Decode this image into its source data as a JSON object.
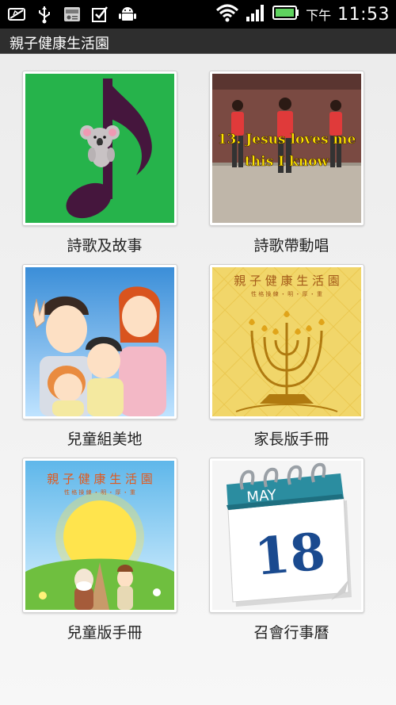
{
  "status_bar": {
    "left_icons": [
      "photo-icon",
      "usb-icon",
      "radio-app-icon",
      "checkbox-icon",
      "android-debug-icon"
    ],
    "right_icons": [
      "wifi-icon",
      "signal-icon",
      "battery-icon"
    ],
    "ampm": "下午",
    "time": "11:53",
    "battery_color": "#5fd35f"
  },
  "app": {
    "title": "親子健康生活園"
  },
  "tiles": [
    {
      "label": "詩歌及故事",
      "icon": "music-note-koala",
      "bg": "#26b34b"
    },
    {
      "label": "詩歌帶動唱",
      "icon": "video-thumbnail",
      "overlay_line1": "13. Jesus loves me",
      "overlay_line2": "this I know"
    },
    {
      "label": "兒童組美地",
      "icon": "family-illustration"
    },
    {
      "label": "家長版手冊",
      "icon": "menorah-cover",
      "cover_title": "親 子 健 康 生 活 園",
      "cover_subtitle": "性 格 操 練 ・ 明 ・ 厚 ・ 重"
    },
    {
      "label": "兒童版手冊",
      "icon": "children-book-cover",
      "cover_title": "親 子 健 康 生 活 園",
      "cover_subtitle": "性 格 操 練 ・ 明 ・ 厚 ・ 重"
    },
    {
      "label": "召會行事曆",
      "icon": "calendar",
      "month": "MAY",
      "day": "18"
    }
  ]
}
